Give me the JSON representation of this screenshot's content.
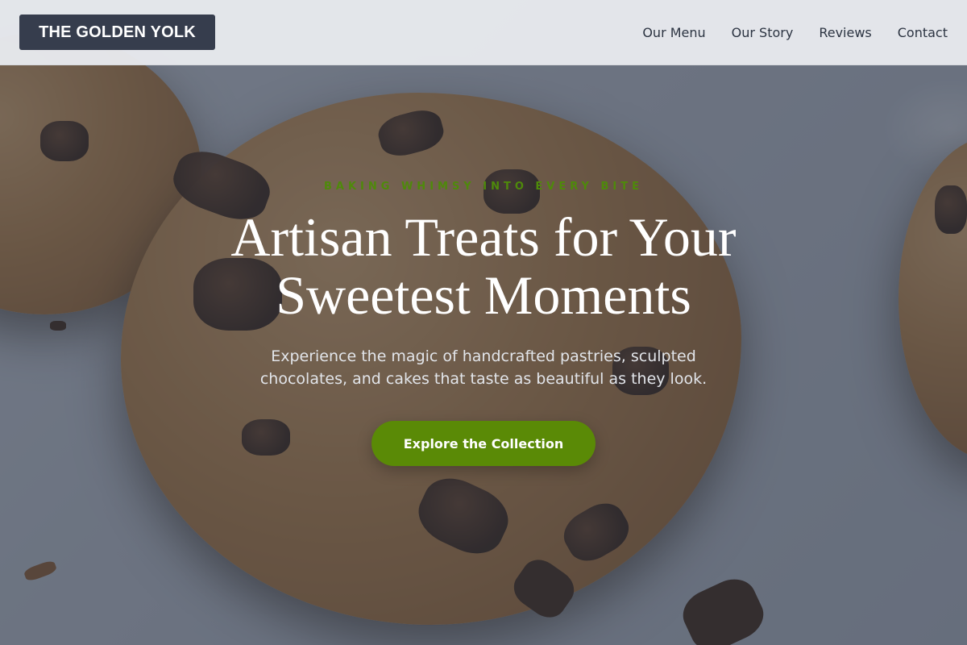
{
  "brand": {
    "name": "THE GOLDEN YOLK"
  },
  "nav": {
    "items": [
      {
        "label": "Our Menu"
      },
      {
        "label": "Our Story"
      },
      {
        "label": "Reviews"
      },
      {
        "label": "Contact"
      }
    ]
  },
  "hero": {
    "eyebrow": "Baking whimsy into every bite",
    "headline": "Artisan Treats for Your Sweetest Moments",
    "subtitle": "Experience the magic of handcrafted pastries, sculpted chocolates, and cakes that taste as beautiful as they look.",
    "cta_label": "Explore the Collection",
    "background_image": "chocolate-chip-cookies-photo"
  },
  "colors": {
    "accent": "#5a8a06",
    "eyebrow": "#4e8a0a",
    "logo_bg": "#363d4d",
    "header_bg": "#e8eaee",
    "nav_text": "#2c3442"
  }
}
